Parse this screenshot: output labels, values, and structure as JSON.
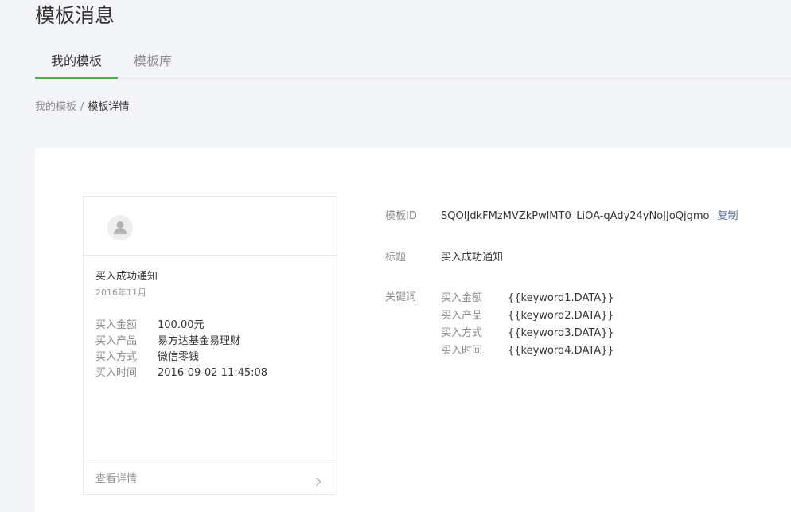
{
  "page_title": "模板消息",
  "tabs": [
    {
      "label": "我的模板",
      "active": true
    },
    {
      "label": "模板库",
      "active": false
    }
  ],
  "breadcrumb": {
    "parent": "我的模板",
    "separator": "/",
    "current": "模板详情"
  },
  "preview": {
    "avatar_icon": "user-avatar-icon",
    "title": "买入成功通知",
    "date": "2016年11月",
    "rows": [
      {
        "label": "买入金额",
        "value": "100.00元"
      },
      {
        "label": "买入产品",
        "value": "易方达基金易理财"
      },
      {
        "label": "买入方式",
        "value": "微信零钱"
      },
      {
        "label": "买入时间",
        "value": "2016-09-02 11:45:08"
      }
    ],
    "footer_link": "查看详情",
    "footer_icon": "chevron-right-icon"
  },
  "details": {
    "template_id_label": "模板ID",
    "template_id": "SQOIJdkFMzMVZkPwlMT0_LiOA-qAdy24yNoJJoQjgmo",
    "copy_label": "复制",
    "title_label": "标题",
    "title_value": "买入成功通知",
    "keywords_label": "关键词",
    "keywords": [
      {
        "name": "买入金额",
        "value": "{{keyword1.DATA}}"
      },
      {
        "name": "买入产品",
        "value": "{{keyword2.DATA}}"
      },
      {
        "name": "买入方式",
        "value": "{{keyword3.DATA}}"
      },
      {
        "name": "买入时间",
        "value": "{{keyword4.DATA}}"
      }
    ]
  },
  "colors": {
    "accent": "#44b549",
    "link": "#576b95",
    "muted": "#8d8d8d",
    "text": "#353535",
    "background": "#f4f5f9"
  }
}
